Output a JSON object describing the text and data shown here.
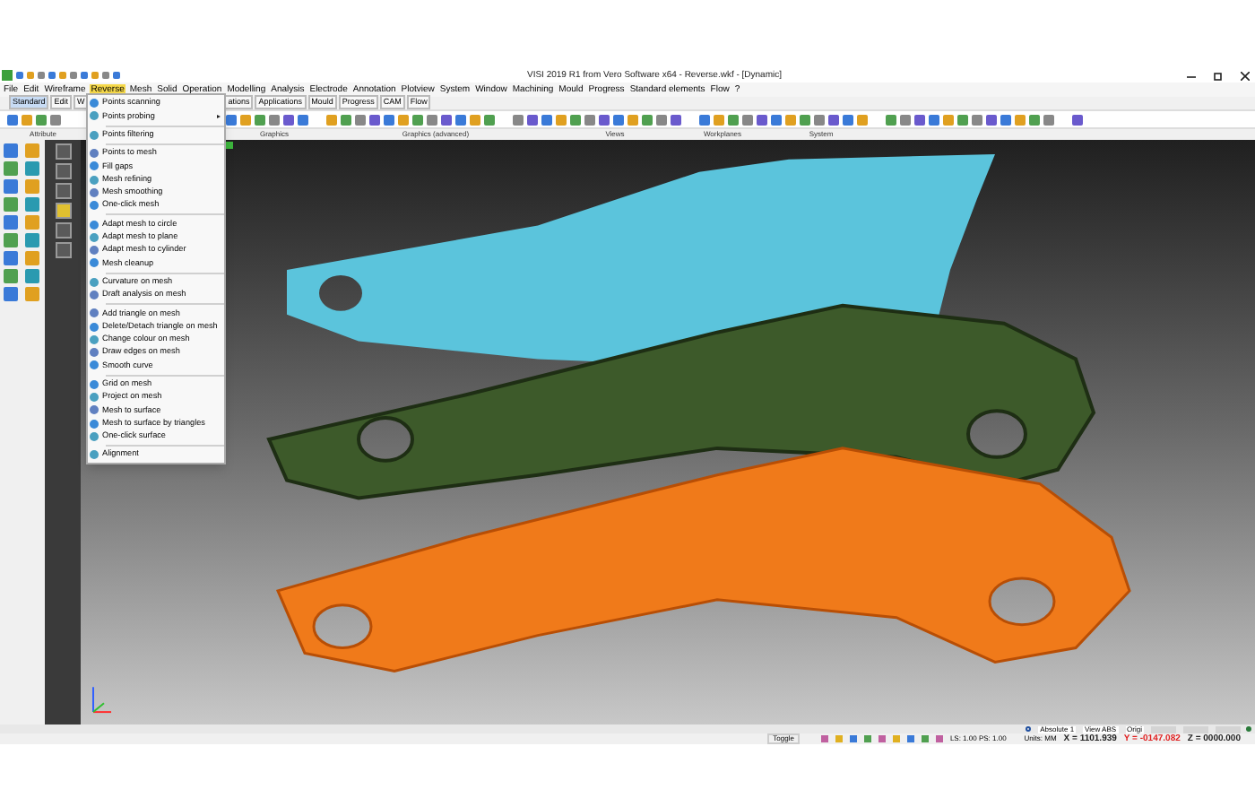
{
  "window": {
    "title": "VISI 2019 R1 from Vero Software x64 - Reverse.wkf - [Dynamic]"
  },
  "menu_bar": [
    {
      "label": "File",
      "selected": false
    },
    {
      "label": "Edit",
      "selected": false
    },
    {
      "label": "Wireframe",
      "selected": false
    },
    {
      "label": "Reverse",
      "selected": true
    },
    {
      "label": "Mesh",
      "selected": false
    },
    {
      "label": "Solid",
      "selected": false
    },
    {
      "label": "Operation",
      "selected": false
    },
    {
      "label": "Modelling",
      "selected": false
    },
    {
      "label": "Analysis",
      "selected": false
    },
    {
      "label": "Electrode",
      "selected": false
    },
    {
      "label": "Annotation",
      "selected": false
    },
    {
      "label": "Plotview",
      "selected": false
    },
    {
      "label": "System",
      "selected": false
    },
    {
      "label": "Window",
      "selected": false
    },
    {
      "label": "Machining",
      "selected": false
    },
    {
      "label": "Mould",
      "selected": false
    },
    {
      "label": "Progress",
      "selected": false
    },
    {
      "label": "Standard elements",
      "selected": false
    },
    {
      "label": "Flow",
      "selected": false
    },
    {
      "label": "?",
      "selected": false
    }
  ],
  "toolbar_tabs": [
    {
      "label": "Standard",
      "selected": true
    },
    {
      "label": "Edit",
      "selected": false
    },
    {
      "label": "W",
      "selected": false
    },
    {
      "label": "ations",
      "selected": false
    },
    {
      "label": "Applications",
      "selected": false
    },
    {
      "label": "Mould",
      "selected": false
    },
    {
      "label": "Progress",
      "selected": false
    },
    {
      "label": "CAM",
      "selected": false
    },
    {
      "label": "Flow",
      "selected": false
    }
  ],
  "toolbar_groups": [
    "Attribute",
    "Graphics",
    "Graphics (advanced)",
    "Views",
    "Workplanes",
    "System"
  ],
  "reverse_menu": [
    [
      {
        "label": "Points scanning",
        "has_submenu": false
      },
      {
        "label": "Points probing",
        "has_submenu": true
      }
    ],
    [
      {
        "label": "Points filtering",
        "has_submenu": false
      }
    ],
    [
      {
        "label": "Points to mesh",
        "has_submenu": false
      },
      {
        "label": "Fill gaps",
        "has_submenu": false
      },
      {
        "label": "Mesh refining",
        "has_submenu": false
      },
      {
        "label": "Mesh smoothing",
        "has_submenu": false
      },
      {
        "label": "One-click mesh",
        "has_submenu": false
      }
    ],
    [
      {
        "label": "Adapt mesh to circle",
        "has_submenu": false
      },
      {
        "label": "Adapt mesh to plane",
        "has_submenu": false
      },
      {
        "label": "Adapt mesh to cylinder",
        "has_submenu": false
      },
      {
        "label": "Mesh cleanup",
        "has_submenu": false
      }
    ],
    [
      {
        "label": "Curvature on mesh",
        "has_submenu": false
      },
      {
        "label": "Draft analysis on mesh",
        "has_submenu": false
      }
    ],
    [
      {
        "label": "Add triangle on mesh",
        "has_submenu": false
      },
      {
        "label": "Delete/Detach triangle on mesh",
        "has_submenu": false
      },
      {
        "label": "Change colour on mesh",
        "has_submenu": false
      },
      {
        "label": "Draw edges on mesh",
        "has_submenu": false
      },
      {
        "label": "Smooth curve",
        "has_submenu": false
      }
    ],
    [
      {
        "label": "Grid on mesh",
        "has_submenu": false
      },
      {
        "label": "Project on mesh",
        "has_submenu": false
      },
      {
        "label": "Mesh to surface",
        "has_submenu": false
      },
      {
        "label": "Mesh to surface by triangles",
        "has_submenu": false
      },
      {
        "label": "One-click surface",
        "has_submenu": false
      }
    ],
    [
      {
        "label": "Alignment",
        "has_submenu": false
      }
    ]
  ],
  "status_bar": {
    "top": [
      "Absolute 1",
      "View ABS",
      "Origi"
    ],
    "toggle": "Toggle",
    "scale": "LS: 1.00 PS: 1.00",
    "units": "Units: MM",
    "coords": [
      {
        "text": "X = 1101.939",
        "color": "#222222"
      },
      {
        "text": "Y = -0147.082",
        "color": "#e02020"
      },
      {
        "text": "Z = 0000.000",
        "color": "#222222"
      }
    ]
  }
}
